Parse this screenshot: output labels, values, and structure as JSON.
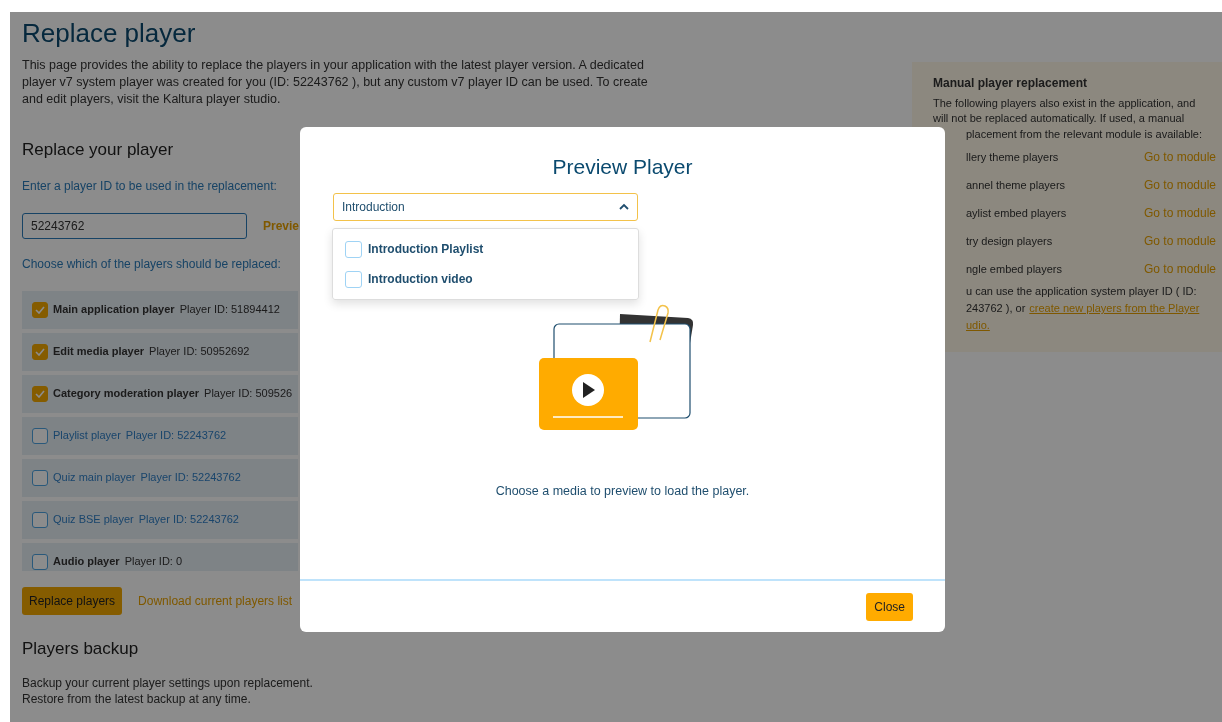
{
  "page": {
    "title": "Replace player",
    "description": "This page provides the ability to replace the players in your application with the latest player version. A dedicated player v7 system player was created for you (ID: 52243762 ), but any custom v7 player ID can be used. To create and edit players, visit the Kaltura player studio.",
    "section_title": "Replace your player",
    "id_label": "Enter a player ID to be used in the replacement:",
    "id_value": "52243762",
    "preview_link": "Previe",
    "choose_label": "Choose which of the players should be replaced:",
    "players": [
      {
        "name": "Main application player",
        "id_text": "Player ID: 51894412",
        "checked": true,
        "disabled": false
      },
      {
        "name": "Edit media player",
        "id_text": "Player ID: 50952692",
        "checked": true,
        "disabled": false
      },
      {
        "name": "Category moderation player",
        "id_text": "Player ID: 509526",
        "checked": true,
        "disabled": false
      },
      {
        "name": "Playlist player",
        "id_text": "Player ID: 52243762",
        "checked": false,
        "disabled": true
      },
      {
        "name": "Quiz main player",
        "id_text": "Player ID: 52243762",
        "checked": false,
        "disabled": true
      },
      {
        "name": "Quiz BSE player",
        "id_text": "Player ID: 52243762",
        "checked": false,
        "disabled": true
      },
      {
        "name": "Audio player",
        "id_text": "Player ID: 0",
        "checked": false,
        "disabled": false
      }
    ],
    "replace_button": "Replace players",
    "download_link": "Download current players list",
    "backup_title": "Players backup",
    "backup_lines": [
      "Backup your current player settings upon replacement.",
      "Restore from the latest backup at any time."
    ]
  },
  "manual_panel": {
    "title": "Manual player replacement",
    "description_lines": [
      "The following players also exist in the application, and",
      "will not be replaced automatically. If used, a manual"
    ],
    "description_cont": "placement from the relevant module is available:",
    "modules": [
      {
        "name": "llery theme players",
        "link": "Go to module"
      },
      {
        "name": "annel theme players",
        "link": "Go to module"
      },
      {
        "name": "aylist embed players",
        "link": "Go to module"
      },
      {
        "name": "try design players",
        "link": "Go to module"
      },
      {
        "name": "ngle embed players",
        "link": "Go to module"
      }
    ],
    "footer_line_1": "u can use the application system player ID ( ID:",
    "footer_line_2": "243762 ), or",
    "footer_link_1": "create new players from the Player",
    "footer_link_2": "udio."
  },
  "modal": {
    "title": "Preview Player",
    "select": {
      "value": "Introduction",
      "expanded": true
    },
    "options": [
      {
        "label": "Introduction Playlist",
        "checked": false
      },
      {
        "label": "Introduction video",
        "checked": false
      }
    ],
    "message": "Choose a media to preview to load the player.",
    "close_button": "Close"
  }
}
